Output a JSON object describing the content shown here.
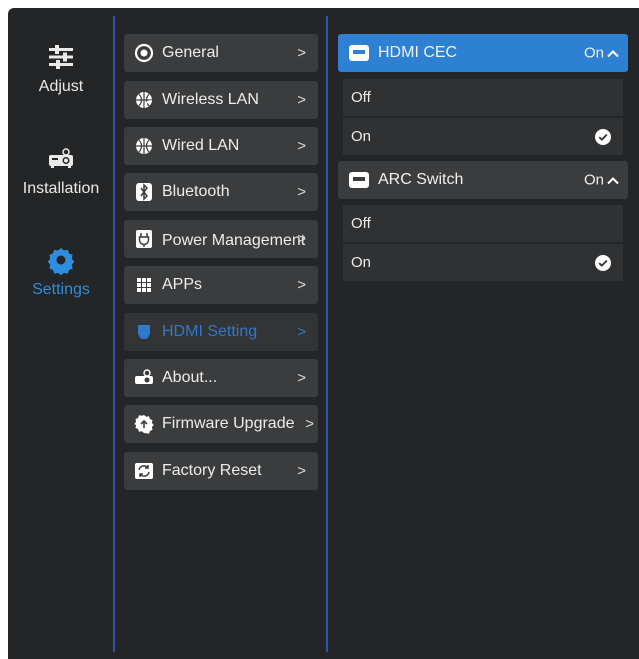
{
  "nav": {
    "items": [
      {
        "label": "Adjust",
        "icon": "sliders-icon",
        "active": false
      },
      {
        "label": "Installation",
        "icon": "projector-icon",
        "active": false
      },
      {
        "label": "Settings",
        "icon": "gear-icon",
        "active": true
      }
    ]
  },
  "menu": {
    "items": [
      {
        "label": "General",
        "icon": "general-icon"
      },
      {
        "label": "Wireless LAN",
        "icon": "wireless-lan-icon"
      },
      {
        "label": "Wired LAN",
        "icon": "globe-icon"
      },
      {
        "label": "Bluetooth",
        "icon": "bluetooth-icon"
      },
      {
        "label": "Power Management",
        "icon": "power-plug-icon"
      },
      {
        "label": "APPs",
        "icon": "apps-grid-icon"
      },
      {
        "label": "HDMI Setting",
        "icon": "hdmi-icon"
      },
      {
        "label": "About...",
        "icon": "projector-info-icon"
      },
      {
        "label": "Firmware Upgrade",
        "icon": "firmware-upgrade-icon"
      },
      {
        "label": "Factory Reset",
        "icon": "factory-reset-icon"
      }
    ],
    "chevron": ">"
  },
  "hdmi_cec": {
    "title": "HDMI CEC",
    "state": "On",
    "options": [
      "Off",
      "On"
    ],
    "selected": "On"
  },
  "arc_switch": {
    "title": "ARC Switch",
    "state": "On",
    "options": [
      "Off",
      "On"
    ],
    "selected": "On"
  },
  "colors": {
    "accent": "#2e80d2",
    "background": "#242526",
    "tile": "#3b3c3d"
  }
}
